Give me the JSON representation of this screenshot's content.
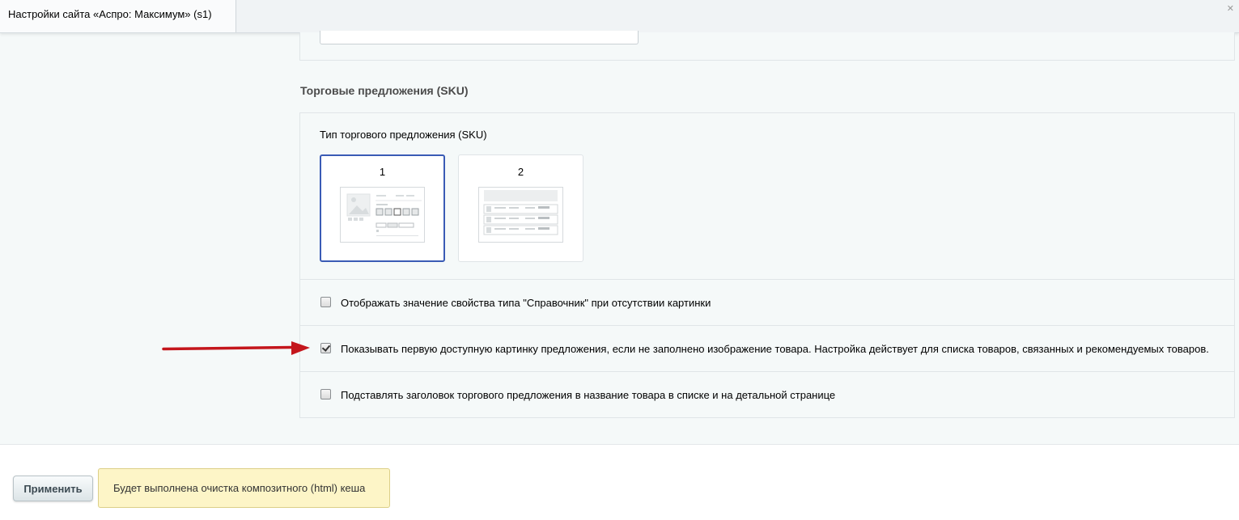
{
  "tab": {
    "title": "Настройки сайта «Аспро: Максимум» (s1)"
  },
  "section": {
    "title": "Торговые предложения (SKU)"
  },
  "sku_type": {
    "label": "Тип торгового предложения (SKU)",
    "options": [
      {
        "label": "1",
        "selected": true
      },
      {
        "label": "2",
        "selected": false
      }
    ]
  },
  "options": [
    {
      "label": "Отображать значение свойства типа \"Справочник\" при отсутствии картинки",
      "checked": false
    },
    {
      "label": "Показывать первую доступную картинку предложения, если не заполнено изображение товара. Настройка действует для списка товаров, связанных и рекомендуемых товаров.",
      "checked": true
    },
    {
      "label": "Подставлять заголовок торгового предложения в название товара в списке и на детальной странице",
      "checked": false
    }
  ],
  "footer": {
    "apply_label": "Применить",
    "notice": "Будет выполнена очистка композитного (html) кеша"
  },
  "colors": {
    "arrow": "#c4161c",
    "selected_border": "#3a5bb5",
    "notice_bg": "#fdf5c7"
  }
}
